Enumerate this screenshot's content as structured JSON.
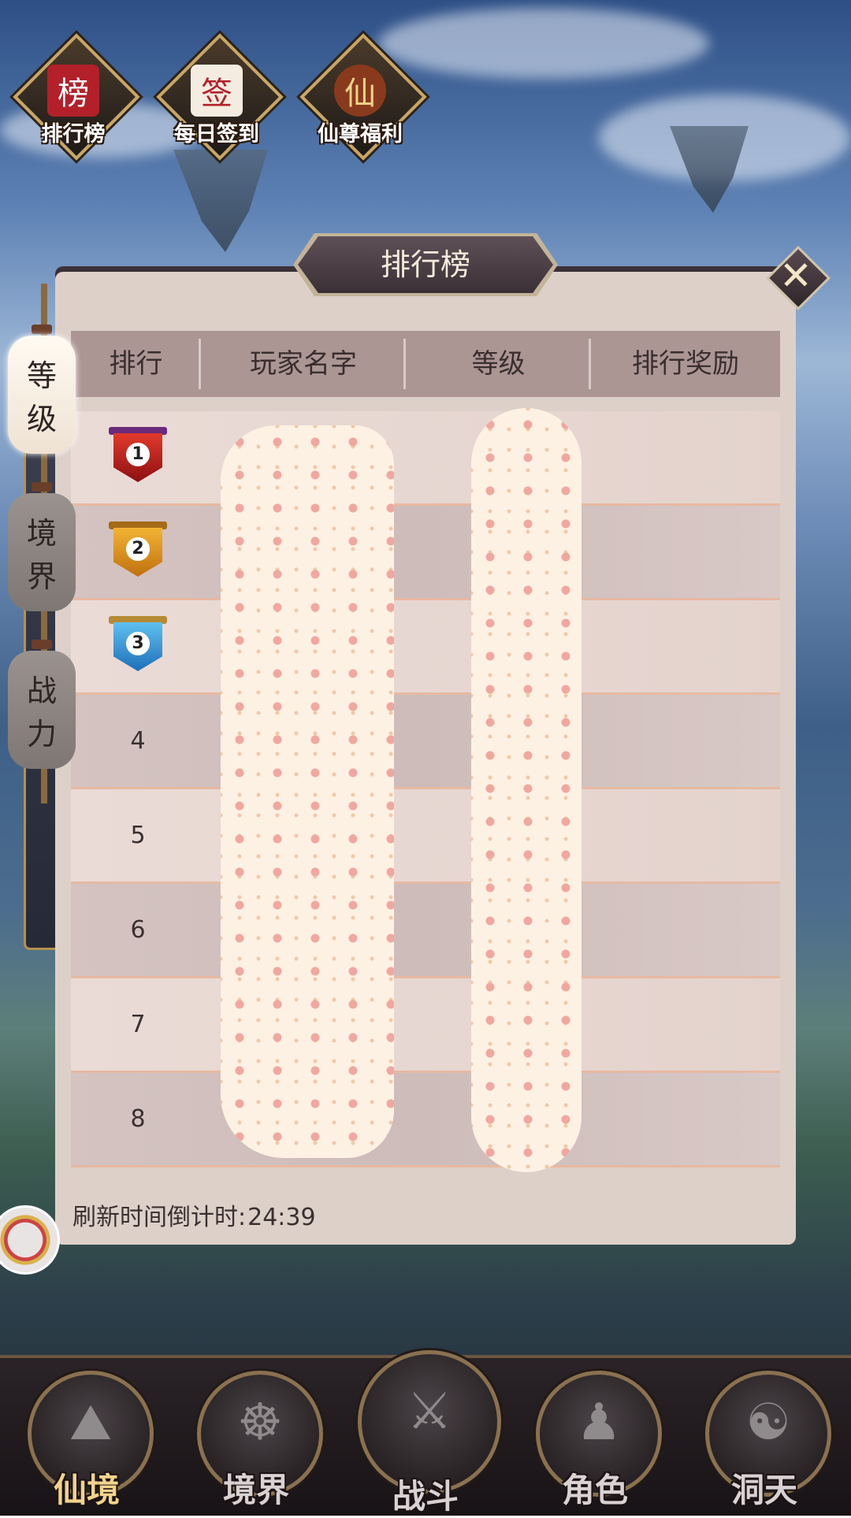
{
  "top_icons": [
    {
      "label": "排行榜",
      "glyph": "榜",
      "icon": "ranking-scroll-icon"
    },
    {
      "label": "每日签到",
      "glyph": "签",
      "icon": "daily-checkin-icon"
    },
    {
      "label": "仙尊福利",
      "glyph": "仙",
      "icon": "welfare-gourd-icon"
    }
  ],
  "panel": {
    "title": "排行榜",
    "close_glyph": "✕"
  },
  "side_tabs": [
    {
      "label1": "等",
      "label2": "级",
      "active": true
    },
    {
      "label1": "境",
      "label2": "界",
      "active": false
    },
    {
      "label1": "战",
      "label2": "力",
      "active": false
    }
  ],
  "table": {
    "headers": [
      "排行",
      "玩家名字",
      "等级",
      "排行奖励"
    ],
    "rows": [
      {
        "rank": "1",
        "medal": true
      },
      {
        "rank": "2",
        "medal": true
      },
      {
        "rank": "3",
        "medal": true
      },
      {
        "rank": "4",
        "medal": false
      },
      {
        "rank": "5",
        "medal": false
      },
      {
        "rank": "6",
        "medal": false
      },
      {
        "rank": "7",
        "medal": false
      },
      {
        "rank": "8",
        "medal": false
      }
    ]
  },
  "footer": {
    "label": "刷新时间倒计时:",
    "countdown": "24:39"
  },
  "bottom_nav": [
    {
      "label": "仙境",
      "icon": "mountain-icon",
      "selected": true
    },
    {
      "label": "境界",
      "icon": "meditation-icon",
      "selected": false
    },
    {
      "label": "战斗",
      "icon": "crossed-swords-icon",
      "selected": false
    },
    {
      "label": "角色",
      "icon": "character-icon",
      "selected": false
    },
    {
      "label": "洞天",
      "icon": "cave-heaven-icon",
      "selected": false
    }
  ],
  "colors": {
    "medal_gold_1": "#c2171b",
    "medal_gold_2": "#e69a1a",
    "medal_blue_3": "#3a93d6",
    "nav_selected": "#f1d38c"
  }
}
